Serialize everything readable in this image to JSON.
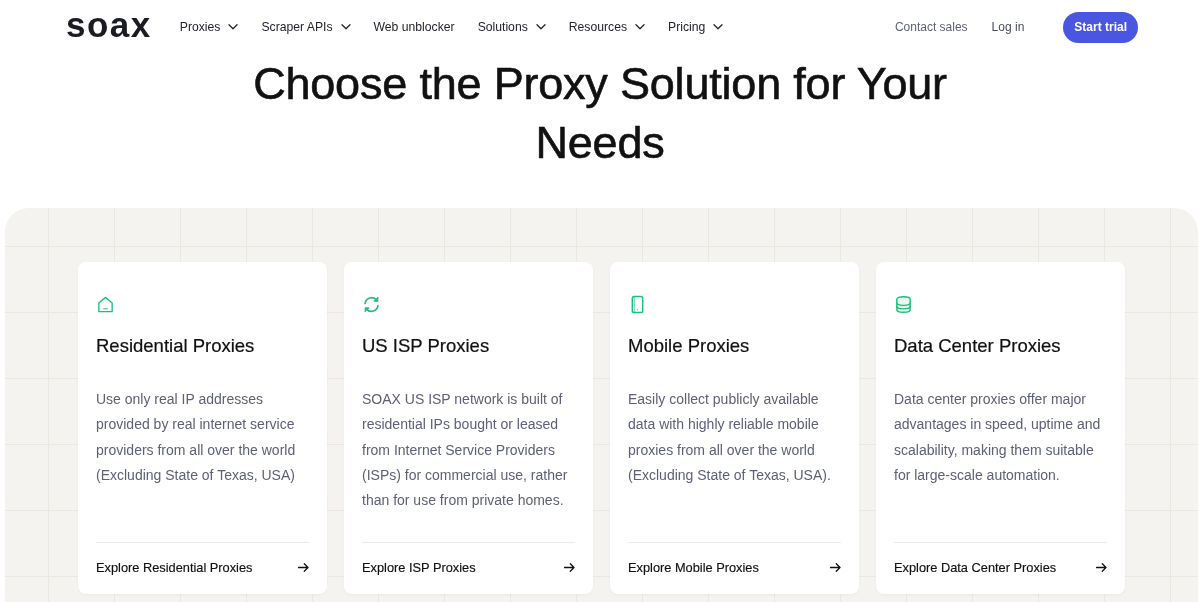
{
  "header": {
    "logo": "soax",
    "nav": [
      {
        "label": "Proxies",
        "has_menu": true
      },
      {
        "label": "Scraper APIs",
        "has_menu": true
      },
      {
        "label": "Web unblocker",
        "has_menu": false
      },
      {
        "label": "Solutions",
        "has_menu": true
      },
      {
        "label": "Resources",
        "has_menu": true
      },
      {
        "label": "Pricing",
        "has_menu": true
      }
    ],
    "contact": "Contact sales",
    "login": "Log in",
    "cta": "Start trial"
  },
  "hero": {
    "title": "Choose the Proxy Solution for Your Needs"
  },
  "cards": [
    {
      "title": "Residential Proxies",
      "description": "Use only real IP addresses provided by real internet service providers from all over the world (Excluding State of Texas, USA)",
      "link": "Explore Residential Proxies"
    },
    {
      "title": "US ISP Proxies",
      "description": "SOAX US ISP network is built of residential IPs bought or leased from Internet Service Providers (ISPs) for commercial use, rather than for use from private homes.",
      "link": "Explore ISP Proxies"
    },
    {
      "title": "Mobile Proxies",
      "description": "Easily collect publicly available data with highly reliable mobile proxies from all over the world (Excluding State of Texas, USA).",
      "link": "Explore Mobile Proxies"
    },
    {
      "title": "Data Center Proxies",
      "description": "Data center proxies offer major advantages in speed, uptime and scalability, making them suitable for large-scale automation.",
      "link": "Explore Data Center Proxies"
    }
  ]
}
